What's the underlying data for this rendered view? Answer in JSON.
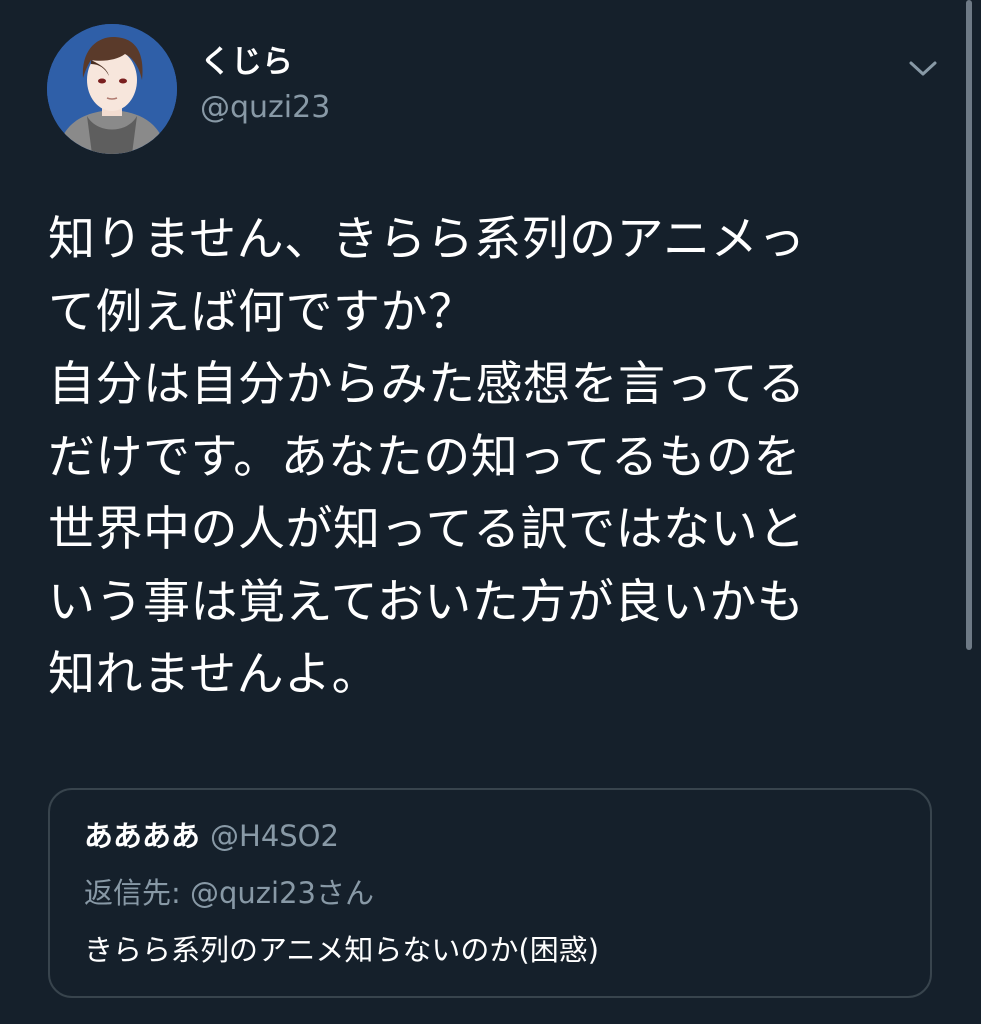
{
  "tweet": {
    "author": {
      "display_name": "くじら",
      "handle": "@quzi23",
      "avatar_icon": "user-avatar"
    },
    "menu_icon": "chevron-down-icon",
    "text": "知りません、きらら系列のアニメっ\nて例えば何ですか？\n自分は自分からみた感想を言ってる\nだけです。あなたの知ってるものを\n世界中の人が知ってる訳ではないと\nいう事は覚えておいた方が良いかも\n知れませんよ。"
  },
  "quoted_tweet": {
    "display_name": "ああああ",
    "handle": "@H4SO2",
    "reply_prefix": "返信先: ",
    "reply_to": "@quzi23さん",
    "text": "きらら系列のアニメ知らないのか(困惑)"
  },
  "colors": {
    "background": "#15202b",
    "secondary_text": "#8899a6",
    "border": "#38444d"
  }
}
